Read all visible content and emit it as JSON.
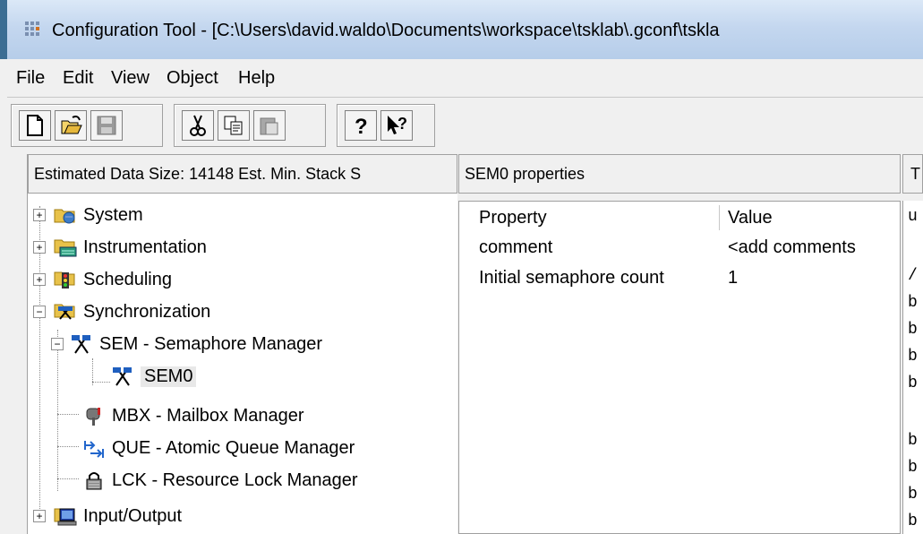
{
  "window": {
    "title": "Configuration Tool - [C:\\Users\\david.waldo\\Documents\\workspace\\tsklab\\.gconf\\tskla"
  },
  "menu": [
    "File",
    "Edit",
    "View",
    "Object",
    "Help"
  ],
  "toolbar": {
    "buttons": [
      "new-file-icon",
      "open-folder-icon",
      "save-disk-icon",
      "cut-icon",
      "copy-icon",
      "paste-icon",
      "help-icon",
      "context-help-icon"
    ]
  },
  "left_panel": {
    "header": "Estimated Data Size: 14148   Est. Min. Stack S",
    "tree": [
      {
        "label": "System",
        "icon": "system-icon",
        "expander": "+"
      },
      {
        "label": "Instrumentation",
        "icon": "instrumentation-icon",
        "expander": "+"
      },
      {
        "label": "Scheduling",
        "icon": "scheduling-icon",
        "expander": "+"
      },
      {
        "label": "Synchronization",
        "icon": "synchronization-icon",
        "expander": "−"
      },
      {
        "label": "SEM - Semaphore Manager",
        "icon": "semaphore-flags-icon",
        "expander": "−"
      },
      {
        "label": "SEM0",
        "icon": "semaphore-flags-icon"
      },
      {
        "label": "MBX - Mailbox Manager",
        "icon": "mailbox-icon"
      },
      {
        "label": "QUE - Atomic Queue Manager",
        "icon": "queue-icon"
      },
      {
        "label": "LCK - Resource Lock Manager",
        "icon": "lock-icon"
      },
      {
        "label": "Input/Output",
        "icon": "computer-icon",
        "expander": "+"
      }
    ]
  },
  "mid_panel": {
    "header": "SEM0 properties",
    "columns": [
      "Property",
      "Value"
    ],
    "rows": [
      {
        "property": "comment",
        "value": "<add comments"
      },
      {
        "property": "Initial semaphore count",
        "value": "1"
      }
    ]
  },
  "right_panel": {
    "header": "T",
    "lines": [
      "u",
      "/",
      "b",
      "b",
      "b",
      "b",
      "b",
      "b",
      "b",
      "b"
    ]
  },
  "colors": {
    "title_gradient": "#c4d7ef",
    "tree_text": "#000000",
    "selection": "#e8e8e8"
  }
}
